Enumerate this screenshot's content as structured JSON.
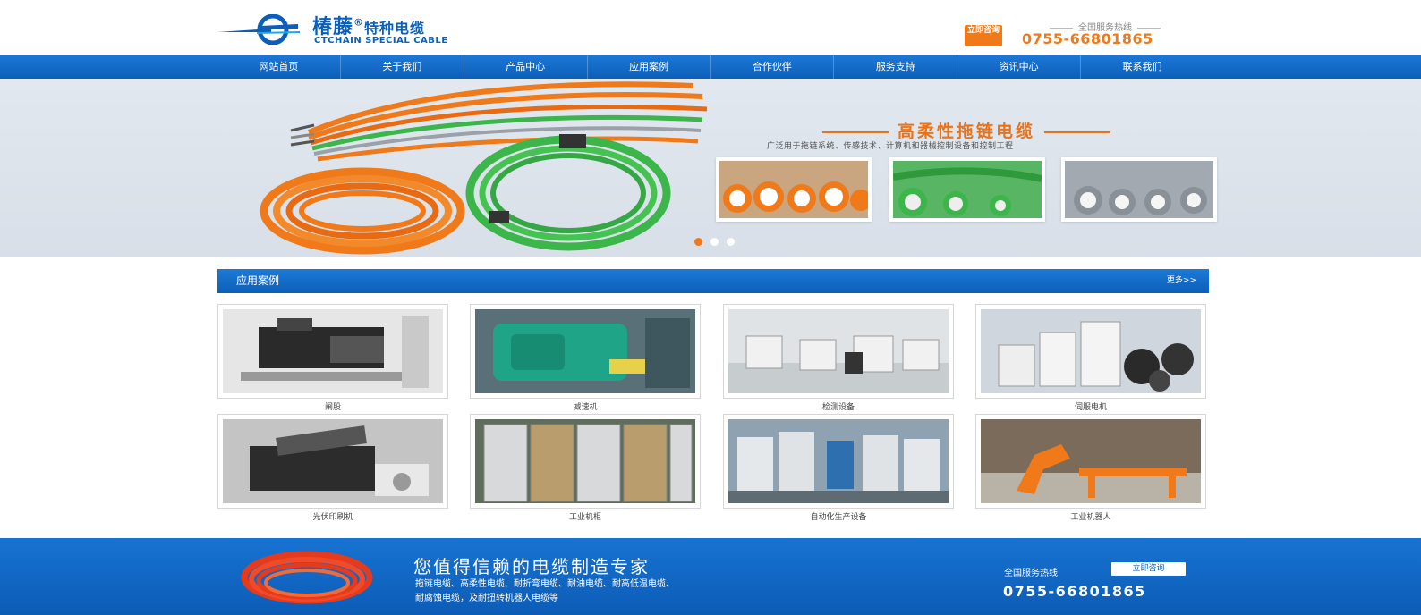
{
  "header": {
    "logo_cn": "椿藤",
    "logo_reg": "®",
    "logo_cn_sub": "特种电缆",
    "logo_en": "CTCHAIN SPECIAL CABLE",
    "consult_badge": "立即咨询",
    "hotline_label": "全国服务热线",
    "hotline_number": "0755-66801865"
  },
  "nav": {
    "items": [
      "网站首页",
      "关于我们",
      "产品中心",
      "应用案例",
      "合作伙伴",
      "服务支持",
      "资讯中心",
      "联系我们"
    ]
  },
  "banner": {
    "title": "高柔性拖链电缆",
    "subtitle": "广泛用于拖链系统、传感技术、计算机和器械控制设备和控制工程",
    "slides": 3,
    "active_slide": 1,
    "colors": {
      "orange": "#f07a1a",
      "green": "#3cb54a",
      "grey": "#8a9097"
    }
  },
  "section": {
    "title": "应用案例",
    "more": "更多>>",
    "cases": [
      {
        "label": "闸股",
        "icon": "machine-photo"
      },
      {
        "label": "减速机",
        "icon": "gearbox-photo"
      },
      {
        "label": "检测设备",
        "icon": "factory-photo"
      },
      {
        "label": "伺服电机",
        "icon": "servo-photo"
      },
      {
        "label": "光伏印刷机",
        "icon": "printer-photo"
      },
      {
        "label": "工业机柜",
        "icon": "cabinet-photo"
      },
      {
        "label": "自动化生产设备",
        "icon": "production-line-photo"
      },
      {
        "label": "工业机器人",
        "icon": "robot-photo"
      }
    ]
  },
  "footer": {
    "slogan": "您值得信赖的电缆制造专家",
    "products_line1": "拖链电缆、高柔性电缆、耐折弯电缆、耐油电缆、耐高低温电缆、",
    "products_line2": "耐腐蚀电缆，及耐扭转机器人电缆等",
    "hotline_label": "全国服务热线",
    "consult_button": "立即咨询",
    "hotline_number": "0755-66801865"
  }
}
